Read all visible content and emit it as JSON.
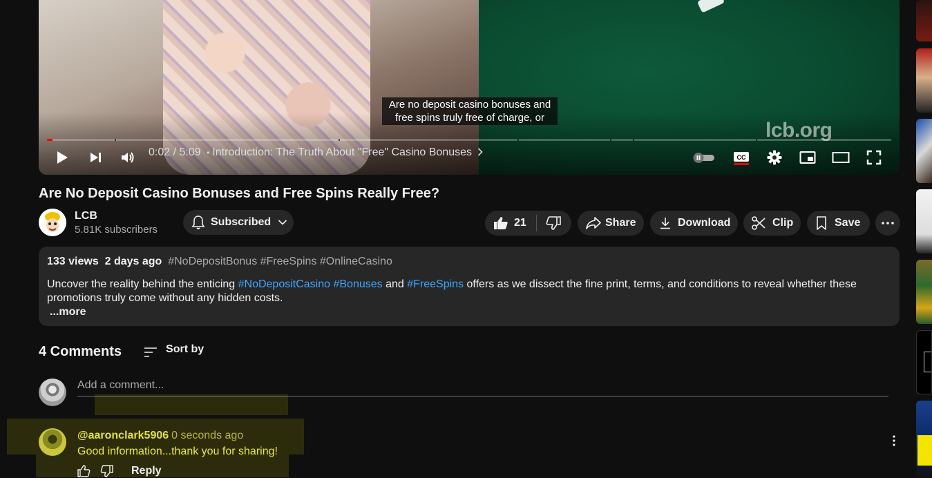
{
  "video": {
    "caption_line1": "Are no deposit casino bonuses and",
    "caption_line2": "free spins truly free of charge, or",
    "watermark": "lcb.org",
    "time_current": "0:02",
    "time_total": "5:09",
    "time_separator": " / ",
    "chapter_bullet": "•",
    "chapter": "Introduction: The Truth About \"Free\" Casino Bonuses",
    "progress_fraction": 0.0065,
    "controls": [
      "play-icon",
      "next-icon",
      "volume-icon",
      "autoplay-toggle",
      "captions-icon",
      "settings-icon",
      "miniplayer-icon",
      "theater-icon",
      "fullscreen-icon"
    ]
  },
  "title": "Are No Deposit Casino Bonuses and Free Spins Really Free?",
  "channel": {
    "name": "LCB",
    "subscribers": "5.81K subscribers",
    "subscribe_label": "Subscribed"
  },
  "actions": {
    "like_count": "21",
    "share": "Share",
    "download": "Download",
    "clip": "Clip",
    "save": "Save"
  },
  "description": {
    "views": "133 views",
    "age": "2 days ago",
    "tags": "#NoDepositBonus #FreeSpins #OnlineCasino",
    "text_1": "Uncover the reality behind the enticing ",
    "link_1": "#NoDepositCasino",
    "link_2": "#Bonuses",
    "text_2": " and ",
    "link_3": "#FreeSpins",
    "text_3": " offers as we dissect the fine print, terms, and conditions to reveal whether these promotions truly come without any hidden costs.",
    "more": "...more"
  },
  "comments": {
    "count_label": "4 Comments",
    "sort_label": "Sort by",
    "add_placeholder": "Add a comment...",
    "items": [
      {
        "handle": "@aaronclark5906",
        "time": "0 seconds ago",
        "text": "Good information...thank you for sharing!",
        "reply": "Reply"
      }
    ]
  },
  "colors": {
    "background": "#0f0f0f",
    "pill": "#272727",
    "link": "#3ea6ff",
    "progress": "#ff0000",
    "highlight": "#e5e234"
  }
}
